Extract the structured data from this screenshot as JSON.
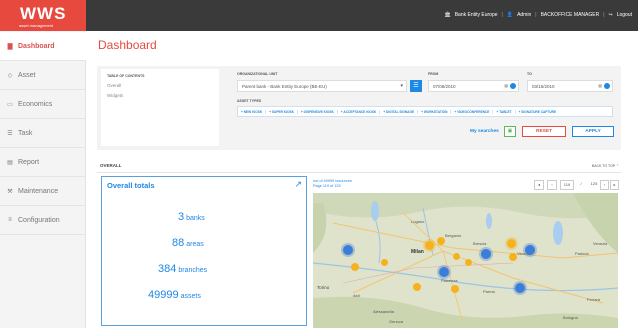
{
  "brand": {
    "name": "WWS",
    "tagline": "asset management"
  },
  "topnav": {
    "company": "Bank Entity Europe",
    "user": "Admin",
    "role": "BACKOFFICE MANAGER",
    "logout": "Logout"
  },
  "sidebar": {
    "items": [
      {
        "label": "Dashboard",
        "icon": "chart-icon"
      },
      {
        "label": "Asset",
        "icon": "tag-icon"
      },
      {
        "label": "Economics",
        "icon": "money-icon"
      },
      {
        "label": "Task",
        "icon": "list-icon"
      },
      {
        "label": "Report",
        "icon": "report-icon"
      },
      {
        "label": "Maintenance",
        "icon": "wrench-icon"
      },
      {
        "label": "Configuration",
        "icon": "sliders-icon"
      }
    ]
  },
  "page": {
    "title": "Dashboard"
  },
  "toc": {
    "title": "TABLE OF CONTENTS",
    "items": [
      "Overall",
      "Widgets"
    ]
  },
  "filters": {
    "org_label": "ORGANIZATIONAL UNIT",
    "org_value": "Parent bank - Bank Entity Europe (BE-EU)",
    "from_label": "FROM",
    "from_value": "07/08/2010",
    "to_label": "TO",
    "to_value": "03/15/2010",
    "types_label": "ASSET TYPES",
    "types": [
      "NEW KIOSK",
      "SUPER KIOSK",
      "DISPENSIVE KIOSK",
      "ACCEPTANCE KIOSK",
      "DIGITAL SIGNAGE",
      "WORKSTATION",
      "VIDEOCONFERENCE",
      "TABLET",
      "SIGNATURE CAPTURE"
    ],
    "my_searches": "My searches",
    "reset": "RESET",
    "apply": "APPLY"
  },
  "overall": {
    "title": "OVERALL",
    "back_to_top": "BACK TO TOP"
  },
  "totals": {
    "title": "Overall totals",
    "stats": [
      {
        "value": "3",
        "unit": "banks"
      },
      {
        "value": "88",
        "unit": "areas"
      },
      {
        "value": "384",
        "unit": "branches"
      },
      {
        "value": "49999",
        "unit": "assets"
      }
    ]
  },
  "map": {
    "meta1": "out of 49999 resources",
    "meta2": "Page 119 of 125",
    "page_current": "119",
    "page_total": "125",
    "places": [
      "Lugano",
      "Bergamo",
      "Milan",
      "Brescia",
      "Verona",
      "Torino",
      "Asti",
      "Piacenza",
      "Parma",
      "Alessandria",
      "Padova",
      "Venezia",
      "Genova",
      "Bologna",
      "Ferrara"
    ]
  },
  "colors": {
    "accent": "#e8493f",
    "link": "#1e88e5",
    "cluster_orange": "#f6b21d",
    "cluster_blue": "#3b7dd8"
  }
}
